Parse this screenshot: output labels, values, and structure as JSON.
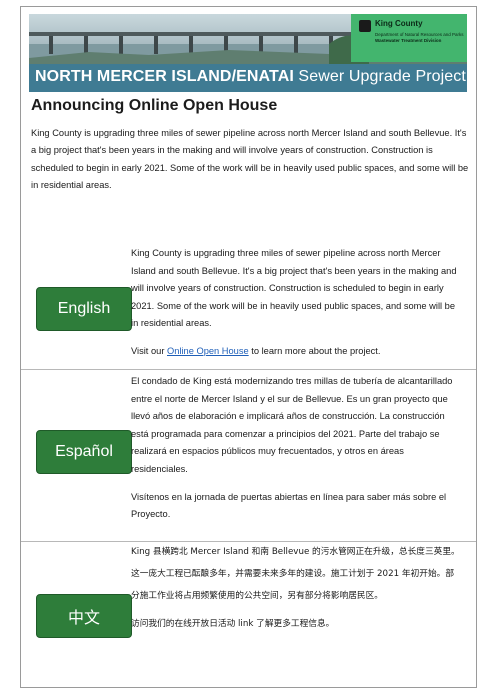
{
  "banner": {
    "title_bold": "NORTH MERCER ISLAND/ENATAI",
    "title_rest": " Sewer Upgrade Project",
    "logo_name": "King County",
    "logo_dept": "Department of Natural Resources and Parks",
    "logo_division": "Wastewater Treatment Division"
  },
  "headline": "Announcing Online Open House",
  "intro": "King County is upgrading three miles of sewer pipeline across north Mercer Island and south Bellevue. It's a big project that's been years in the making and will involve years of construction. Construction is scheduled to begin in early 2021. Some of the work will be in heavily used public spaces, and some will be in residential areas.",
  "sections": {
    "english": {
      "button": "English",
      "body": "King County is upgrading three miles of sewer pipeline across north Mercer Island and south Bellevue. It's a big project that's been years in the making and will involve years of construction. Construction is scheduled to begin in early 2021. Some of the work will be in heavily used public spaces, and some will be in residential areas.",
      "visit_prefix": "Visit our ",
      "visit_link": "Online Open House",
      "visit_suffix": " to learn more about the project."
    },
    "spanish": {
      "button": "Español",
      "body": "El condado de King está modernizando tres millas de tubería de alcantarillado entre el norte de Mercer Island y el sur de Bellevue. Es un gran proyecto que llevó años de elaboración e implicará años de construcción. La construcción está programada para comenzar a principios del 2021. Parte del trabajo se realizará en espacios públicos muy frecuentados, y otros en áreas residenciales.",
      "visit": "Visítenos en la jornada de puertas abiertas en línea para saber más sobre el Proyecto."
    },
    "chinese": {
      "button": "中文",
      "body": "King 县横跨北 Mercer Island 和南 Bellevue 的污水管网正在升级，总长度三英里。这一庞大工程已酝酿多年，并需要未来多年的建设。施工计划于 2021 年初开始。部分施工作业将占用频繁使用的公共空间，另有部分将影响居民区。",
      "visit": "访问我们的在线开放日活动 link 了解更多工程信息。"
    }
  },
  "colors": {
    "button_green": "#2e7d3a",
    "banner_blue": "#3f7b93",
    "logo_green": "#43b56e",
    "link_blue": "#1f5fb8"
  }
}
